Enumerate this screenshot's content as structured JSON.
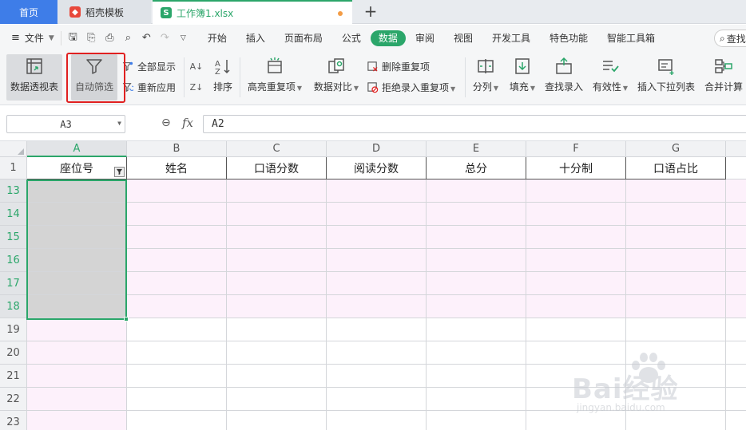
{
  "tabs": {
    "home": "首页",
    "docer": "稻壳模板",
    "file": "工作簿1.xlsx"
  },
  "menu": {
    "file": "文件",
    "items": [
      "开始",
      "插入",
      "页面布局",
      "公式",
      "数据",
      "审阅",
      "视图",
      "开发工具",
      "特色功能",
      "智能工具箱"
    ],
    "active_index": 4,
    "search": "查找"
  },
  "ribbon": {
    "pivot": "数据透视表",
    "auto_filter": "自动筛选",
    "show_all": "全部显示",
    "reapply": "重新应用",
    "sort": "排序",
    "highlight_dup": "高亮重复项",
    "compare": "数据对比",
    "delete_dup": "删除重复项",
    "reject_dup": "拒绝录入重复项",
    "split": "分列",
    "fill": "填充",
    "lookup": "查找录入",
    "validity": "有效性",
    "insert_dropdown": "插入下拉列表",
    "merge_calc": "合并计算"
  },
  "formula_bar": {
    "name_box": "A3",
    "fx": "fx",
    "formula": "A2"
  },
  "sheet": {
    "columns": [
      "A",
      "B",
      "C",
      "D",
      "E",
      "F",
      "G"
    ],
    "header_row": "1",
    "headers": [
      "座位号",
      "姓名",
      "口语分数",
      "阅读分数",
      "总分",
      "十分制",
      "口语占比"
    ],
    "filtered_rows": [
      "13",
      "14",
      "15",
      "16",
      "17",
      "18"
    ],
    "other_rows": [
      "19",
      "20",
      "21",
      "22",
      "23"
    ]
  },
  "watermark": {
    "main": "Bai经验",
    "sub": "jingyan.baidu.com"
  },
  "colors": {
    "accent_green": "#2ba66a",
    "tab_blue": "#3e7de8",
    "highlight_red": "#e02020",
    "pink_fill": "#fdf1fb"
  }
}
